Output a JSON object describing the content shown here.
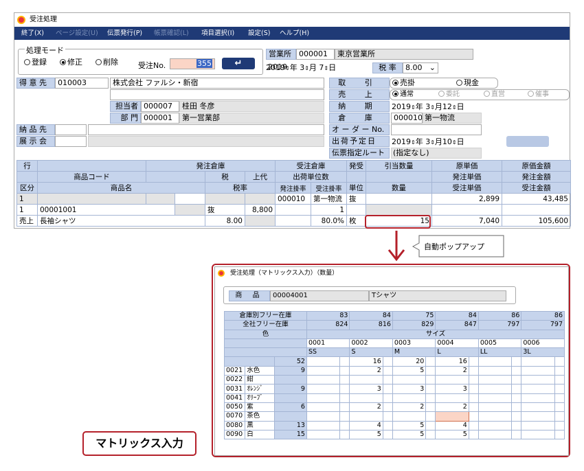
{
  "window1": {
    "title": "受注処理",
    "menu": [
      {
        "label": "終了(X)",
        "enabled": true
      },
      {
        "label": "ページ設定(U)",
        "enabled": false
      },
      {
        "label": "伝票発行(P)",
        "enabled": true
      },
      {
        "label": "帳票確認(L)",
        "enabled": false
      },
      {
        "label": "項目選択(I)",
        "enabled": true
      },
      {
        "label": "設定(S)",
        "enabled": true
      },
      {
        "label": "ヘルプ(H)",
        "enabled": true
      }
    ],
    "mode": {
      "group_label": "処理モード",
      "options": [
        "登録",
        "修正",
        "削除"
      ],
      "selected": "修正"
    },
    "order_no": {
      "label": "受注No.",
      "value": "355"
    },
    "office": {
      "label": "営業所",
      "code": "000001",
      "name": "東京営業所"
    },
    "date": {
      "year": "2019",
      "month": "3",
      "day": "7",
      "y_label": "年",
      "m_label": "月",
      "d_label": "日"
    },
    "tax": {
      "label": "税 率",
      "value": "8.00"
    },
    "customer": {
      "label": "得 意 先",
      "code": "010003",
      "name": "株式会社 ファルシ・新宿"
    },
    "staff": {
      "label": "担当者",
      "code": "000007",
      "name": "桂田 冬彦"
    },
    "dept": {
      "label": "部 門",
      "code": "000001",
      "name": "第一営業部"
    },
    "delivery": {
      "label": "納 品 先"
    },
    "exhibition": {
      "label": "展 示 会"
    },
    "transaction": {
      "label": "取 引",
      "options": [
        "売掛",
        "現金"
      ],
      "selected": "売掛"
    },
    "sales": {
      "label": "売 上",
      "options": [
        "通常",
        "委託",
        "直営",
        "催事"
      ],
      "selected": "通常"
    },
    "due": {
      "label": "納 期",
      "year": "2019",
      "month": "3",
      "day": "12"
    },
    "warehouse": {
      "label": "倉 庫",
      "code": "000010",
      "name": "第一物流"
    },
    "order_field": {
      "label": "オ ー ダ ー No."
    },
    "ship_date": {
      "label": "出荷予定日",
      "year": "2019",
      "month": "3",
      "day": "10"
    },
    "route": {
      "label": "伝票指定ルート",
      "value": "(指定なし)"
    },
    "grid": {
      "h1": [
        "行",
        "発注倉庫",
        "受注倉庫",
        "発受",
        "引当数量",
        "原単価",
        "原価金額"
      ],
      "h2": [
        "商品コード",
        "税",
        "上代",
        "出荷単位数",
        "発注単価",
        "発注金額"
      ],
      "h3": [
        "区分",
        "商品名",
        "税率",
        "発注掛率",
        "受注掛率",
        "単位",
        "数量",
        "受注単価",
        "受注金額"
      ],
      "r1": {
        "row": "1",
        "wh_code": "000010",
        "wh_name": "第一物流",
        "type": "抜",
        "cost": "2,899",
        "cost_amount": "43,485"
      },
      "r2": {
        "row": "1",
        "code": "00001001",
        "tax": "抜",
        "retail": "8,800",
        "unit_qty": "1"
      },
      "r3": {
        "kubun": "売上",
        "name": "長袖シャツ",
        "tax_rate": "8.00",
        "rate": "80.0%",
        "unit": "枚",
        "qty": "15",
        "price": "7,040",
        "amount": "105,600"
      }
    }
  },
  "callout": {
    "label": "自動ポップアップ"
  },
  "window2": {
    "title": "受注処理（マトリックス入力）（数量）",
    "product_label": "商 品",
    "product_code": "00004001",
    "product_name": "Tシャツ",
    "stock_wh_label": "倉庫別フリー在庫",
    "stock_all_label": "全社フリー在庫",
    "color_label": "色",
    "size_label": "サイズ",
    "stock_wh": [
      "83",
      "84",
      "75",
      "84",
      "86",
      "86"
    ],
    "stock_all": [
      "824",
      "816",
      "829",
      "847",
      "797",
      "797"
    ],
    "size_codes": [
      "0001",
      "0002",
      "0003",
      "0004",
      "0005",
      "0006"
    ],
    "size_names": [
      "SS",
      "S",
      "M",
      "L",
      "LL",
      "3L"
    ],
    "totals": {
      "all": "52",
      "cols": [
        "",
        "16",
        "20",
        "16",
        "",
        ""
      ]
    },
    "rows": [
      {
        "code": "0021",
        "name": "水色",
        "total": "9",
        "vals": [
          "",
          "2",
          "5",
          "2",
          "",
          ""
        ]
      },
      {
        "code": "0022",
        "name": "紺",
        "total": "",
        "vals": [
          "",
          "",
          "",
          "",
          "",
          ""
        ]
      },
      {
        "code": "0031",
        "name": "ｵﾚﾝｼﾞ",
        "total": "9",
        "vals": [
          "",
          "3",
          "3",
          "3",
          "",
          ""
        ]
      },
      {
        "code": "0041",
        "name": "ｵﾘｰﾌﾞ",
        "total": "",
        "vals": [
          "",
          "",
          "",
          "",
          "",
          ""
        ]
      },
      {
        "code": "0050",
        "name": "紫",
        "total": "6",
        "vals": [
          "",
          "2",
          "2",
          "2",
          "",
          ""
        ]
      },
      {
        "code": "0070",
        "name": "茶色",
        "total": "",
        "vals": [
          "",
          "",
          "",
          "",
          "",
          ""
        ]
      },
      {
        "code": "0080",
        "name": "黒",
        "total": "13",
        "vals": [
          "",
          "4",
          "5",
          "4",
          "",
          ""
        ]
      },
      {
        "code": "0090",
        "name": "白",
        "total": "15",
        "vals": [
          "",
          "5",
          "5",
          "5",
          "",
          ""
        ]
      }
    ]
  },
  "matrix_label": "マトリックス入力",
  "colors": {
    "menu": "#1f3a76",
    "label_bg": "#c6d4ec",
    "accent_red": "#b4202a",
    "order_no_bg": "#fbd5c6"
  }
}
